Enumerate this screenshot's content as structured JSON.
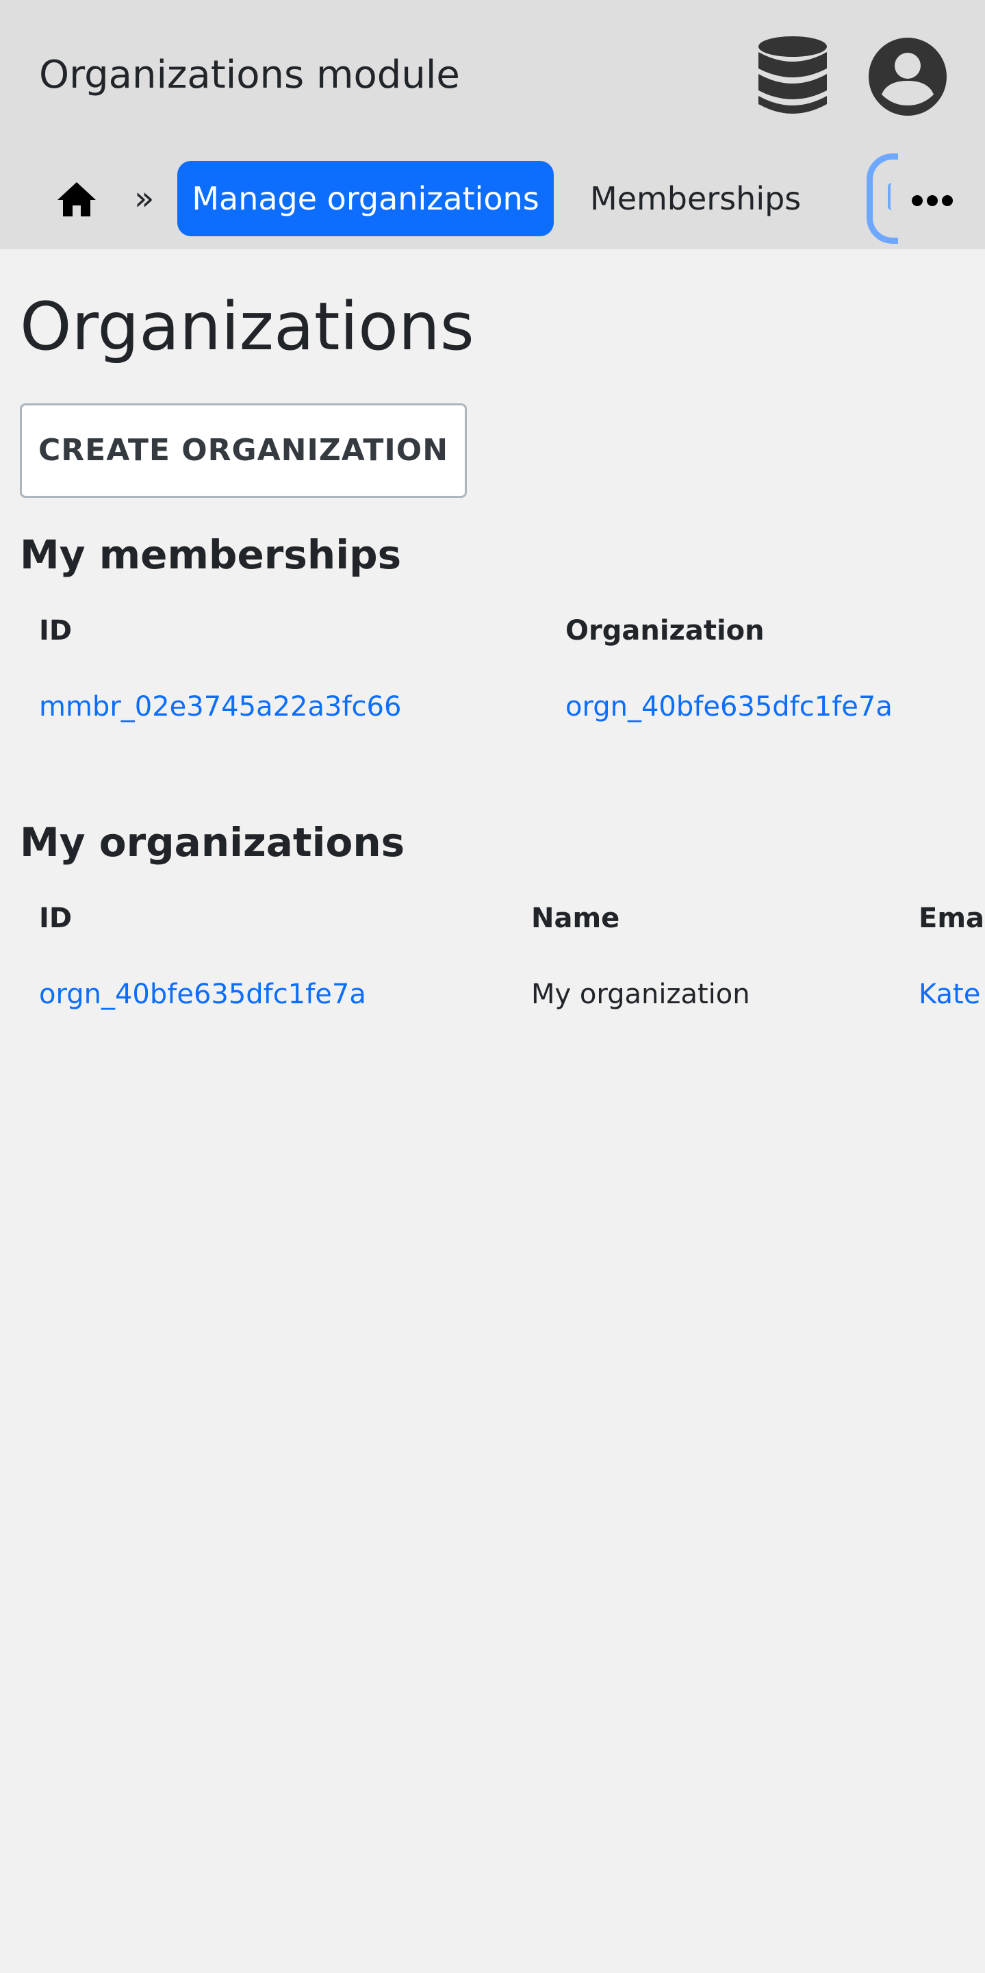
{
  "header": {
    "title": "Organizations module",
    "db_icon": "database-icon",
    "user_icon": "user-circle-icon"
  },
  "nav": {
    "home_icon": "home-icon",
    "separator": "»",
    "active_label": "Manage organizations",
    "items": [
      "Memberships"
    ],
    "partial_item": "O",
    "more_icon": "ellipsis-icon"
  },
  "page": {
    "title": "Organizations",
    "create_button": "CREATE ORGANIZATION"
  },
  "memberships": {
    "title": "My memberships",
    "columns": [
      "ID",
      "Organization"
    ],
    "rows": [
      {
        "id": "mmbr_02e3745a22a3fc66",
        "organization": "orgn_40bfe635dfc1fe7a"
      }
    ]
  },
  "organizations": {
    "title": "My organizations",
    "columns": [
      "ID",
      "Name",
      "Email"
    ],
    "rows": [
      {
        "id": "orgn_40bfe635dfc1fe7a",
        "name": "My organization",
        "email": "Kate"
      }
    ]
  },
  "colors": {
    "primary": "#0d6efd",
    "header_bg": "#dedede",
    "page_bg": "#f1f1f1",
    "icon_dark": "#343434"
  }
}
